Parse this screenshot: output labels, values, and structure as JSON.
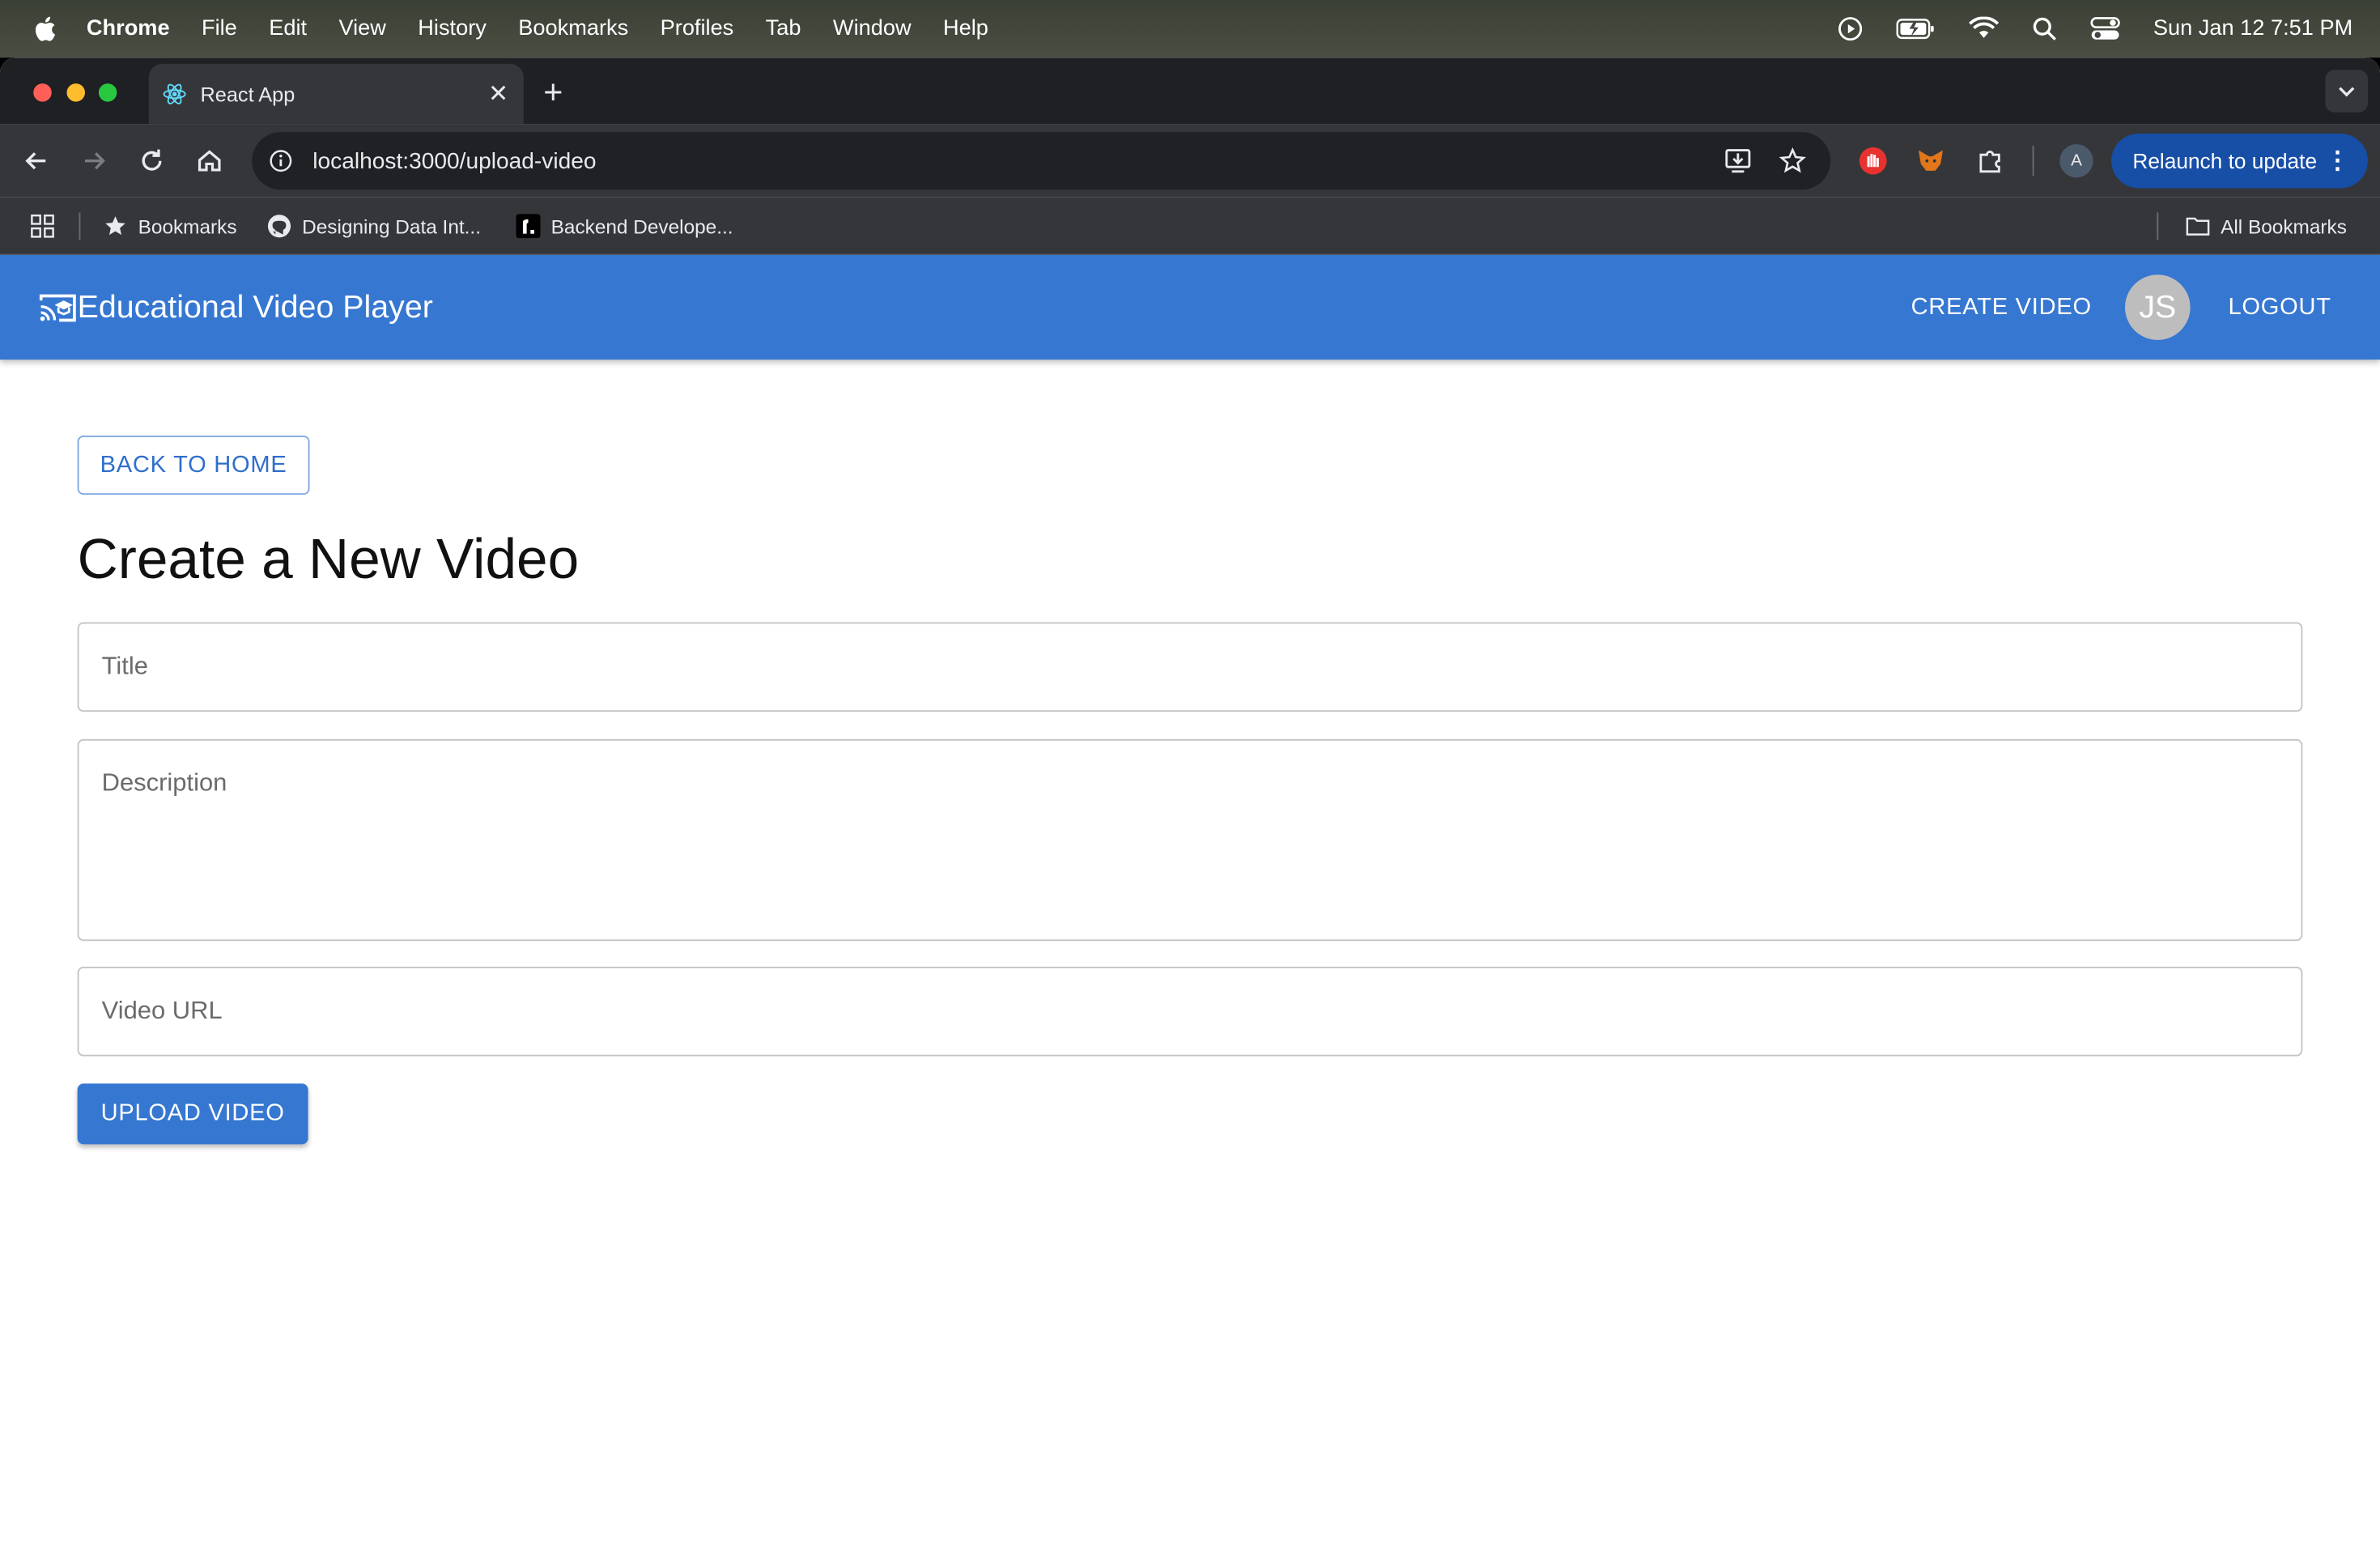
{
  "menubar": {
    "app_name": "Chrome",
    "items": [
      "File",
      "Edit",
      "View",
      "History",
      "Bookmarks",
      "Profiles",
      "Tab",
      "Window",
      "Help"
    ],
    "clock": "Sun Jan 12  7:51 PM"
  },
  "browser": {
    "tab_title": "React App",
    "url": "localhost:3000/upload-video",
    "relaunch_label": "Relaunch to update",
    "profile_initial": "A",
    "bookmarks": {
      "items": [
        "Bookmarks",
        "Designing Data Int...",
        "Backend Develope..."
      ],
      "all_label": "All Bookmarks"
    }
  },
  "app": {
    "brand_name": "Educational Video Player",
    "nav": {
      "create_label": "CREATE VIDEO",
      "avatar_initials": "JS",
      "logout_label": "LOGOUT"
    },
    "back_label": "BACK TO HOME",
    "page_title": "Create a New Video",
    "form": {
      "title_placeholder": "Title",
      "description_placeholder": "Description",
      "url_placeholder": "Video URL",
      "submit_label": "UPLOAD VIDEO"
    }
  },
  "colors": {
    "appbar": "#3677d1",
    "primary": "#2f6fcc",
    "relaunch": "#174ea6"
  }
}
